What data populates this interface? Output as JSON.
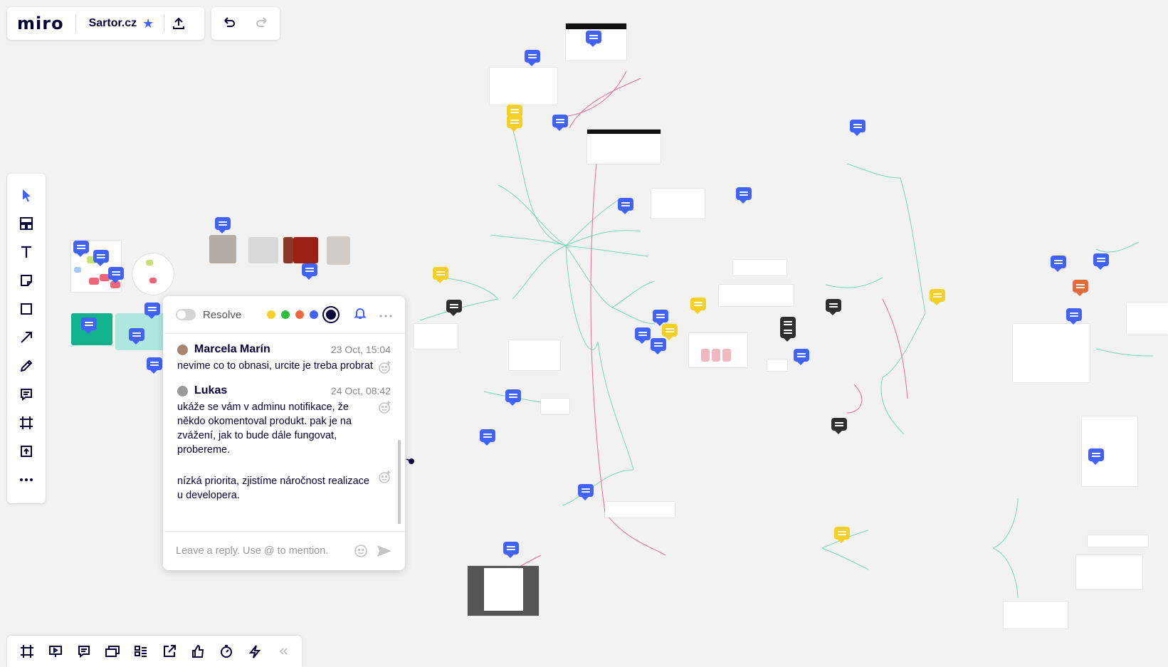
{
  "app": {
    "logo": "miro",
    "board_name": "Sartor.cz"
  },
  "colors": {
    "accent": "#4262ff",
    "comment_blue": "#4262ff",
    "comment_yellow": "#f5d128",
    "comment_dark": "#2e2e2e",
    "comment_orange": "#e56a3c",
    "mindmap_green": "#7dd6b8",
    "mindmap_pink": "#e86a9a"
  },
  "left_toolbar": [
    {
      "name": "select-tool",
      "icon": "cursor-icon"
    },
    {
      "name": "templates-tool",
      "icon": "templates-icon"
    },
    {
      "name": "text-tool",
      "icon": "text-icon"
    },
    {
      "name": "sticky-note-tool",
      "icon": "sticky-note-icon"
    },
    {
      "name": "shape-tool",
      "icon": "shape-icon"
    },
    {
      "name": "connection-line-tool",
      "icon": "arrow-icon"
    },
    {
      "name": "pen-tool",
      "icon": "pen-icon"
    },
    {
      "name": "comment-tool",
      "icon": "comment-icon"
    },
    {
      "name": "frame-tool",
      "icon": "frame-icon"
    },
    {
      "name": "upload-tool",
      "icon": "upload-icon"
    },
    {
      "name": "more-tools",
      "icon": "more-icon"
    }
  ],
  "bottom_toolbar": [
    {
      "name": "frames-button",
      "icon": "frame-icon"
    },
    {
      "name": "presentation-button",
      "icon": "presentation-icon"
    },
    {
      "name": "comments-button",
      "icon": "comment-icon"
    },
    {
      "name": "cards-button",
      "icon": "cards-icon"
    },
    {
      "name": "kanban-button",
      "icon": "kanban-icon"
    },
    {
      "name": "export-button",
      "icon": "export-icon"
    },
    {
      "name": "voting-button",
      "icon": "thumbs-up-icon"
    },
    {
      "name": "timer-button",
      "icon": "timer-icon"
    },
    {
      "name": "apps-button",
      "icon": "lightning-icon"
    },
    {
      "name": "collapse-button",
      "icon": "collapse-icon"
    }
  ],
  "comment_panel": {
    "resolve_label": "Resolve",
    "colors": [
      "#f5d128",
      "#2bbf3c",
      "#f0693c",
      "#4262ff",
      "#050038"
    ],
    "comments": [
      {
        "author": "Marcela Marín",
        "time": "23 Oct, 15:04",
        "text": "nevime co to obnasi, urcite je treba probrat"
      },
      {
        "author": "Lukas",
        "time": "24 Oct, 08:42",
        "text": "ukáže se vám v adminu notifikace, že někdo okomentoval produkt. pak je na zvážení, jak to bude dále fungovat, probereme."
      },
      {
        "author": "",
        "time": "",
        "text": "nízká priorita, zjistíme náročnost realizace u developera."
      }
    ],
    "reply_placeholder": "Leave a reply. Use @ to mention."
  }
}
